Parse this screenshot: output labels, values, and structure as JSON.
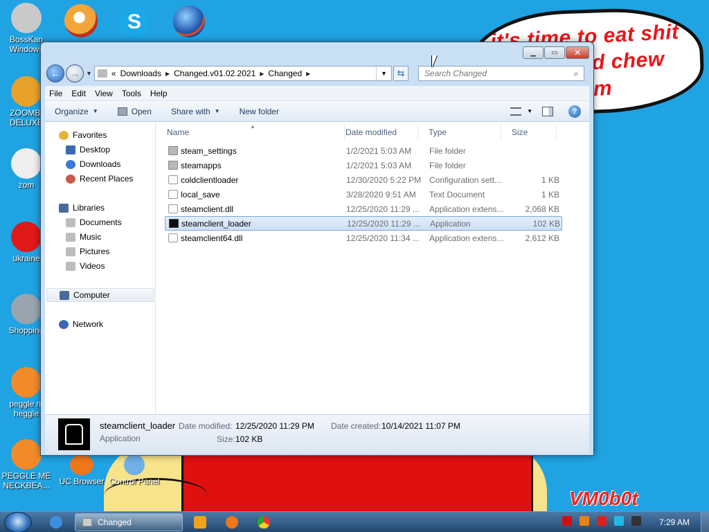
{
  "desktop": {
    "bubble_lines": [
      "it's time to eat shit",
      "d chew",
      "m"
    ],
    "watermark": "VM0b0t",
    "left_icons": [
      {
        "label": "BossKan\nWindows",
        "color": "#c9c9c9"
      },
      {
        "label": "ZOOMBI\nDELUXE",
        "color": "#e8a12a"
      },
      {
        "label": "zom",
        "color": "#eeeeee"
      },
      {
        "label": "ukraine",
        "color": "#e01818"
      },
      {
        "label": "Shopping",
        "color": "#9aa4ae"
      },
      {
        "label": "peggle m\nheggle",
        "color": "#f08a2a"
      },
      {
        "label": "PEGGLE ME\nNECKBEA...",
        "color": "#f08a2a"
      }
    ],
    "bottom_icons": [
      {
        "label": "UC Browser",
        "color": "#f0761a"
      },
      {
        "label": "Control Panel",
        "color": "#6fb0e6"
      }
    ],
    "top_icons": [
      {
        "name": "peggle-icon",
        "color": "#f2a53a"
      },
      {
        "name": "skype-icon",
        "color": "#1aa8e8"
      },
      {
        "name": "browser-globe-icon",
        "color": "#e04a1a"
      }
    ]
  },
  "window": {
    "address": {
      "prefix": "«",
      "crumbs": [
        "Downloads",
        "Changed.v01.02.2021",
        "Changed"
      ]
    },
    "search_placeholder": "Search Changed",
    "menu": [
      "File",
      "Edit",
      "View",
      "Tools",
      "Help"
    ],
    "toolbar": {
      "organize": "Organize",
      "open": "Open",
      "share_with": "Share with",
      "new_folder": "New folder"
    },
    "nav": {
      "favorites": "Favorites",
      "desktop": "Desktop",
      "downloads": "Downloads",
      "recent_places": "Recent Places",
      "libraries": "Libraries",
      "documents": "Documents",
      "music": "Music",
      "pictures": "Pictures",
      "videos": "Videos",
      "computer": "Computer",
      "network": "Network"
    },
    "columns": {
      "name": "Name",
      "date_modified": "Date modified",
      "type": "Type",
      "size": "Size"
    },
    "files": [
      {
        "name": "steam_settings",
        "date": "1/2/2021 5:03 AM",
        "type": "File folder",
        "size": "",
        "kind": "folder",
        "selected": false
      },
      {
        "name": "steamapps",
        "date": "1/2/2021 5:03 AM",
        "type": "File folder",
        "size": "",
        "kind": "folder",
        "selected": false
      },
      {
        "name": "coldclientloader",
        "date": "12/30/2020 5:22 PM",
        "type": "Configuration sett...",
        "size": "1 KB",
        "kind": "file",
        "selected": false
      },
      {
        "name": "local_save",
        "date": "3/28/2020 9:51 AM",
        "type": "Text Document",
        "size": "1 KB",
        "kind": "file",
        "selected": false
      },
      {
        "name": "steamclient.dll",
        "date": "12/25/2020 11:29 ...",
        "type": "Application extens...",
        "size": "2,068 KB",
        "kind": "file",
        "selected": false
      },
      {
        "name": "steamclient_loader",
        "date": "12/25/2020 11:29 ...",
        "type": "Application",
        "size": "102 KB",
        "kind": "app",
        "selected": true
      },
      {
        "name": "steamclient64.dll",
        "date": "12/25/2020 11:34 ...",
        "type": "Application extens...",
        "size": "2,612 KB",
        "kind": "file",
        "selected": false
      }
    ],
    "details": {
      "name": "steamclient_loader",
      "type": "Application",
      "date_modified_label": "Date modified:",
      "date_modified": "12/25/2020 11:29 PM",
      "date_created_label": "Date created:",
      "date_created": "10/14/2021 11:07 PM",
      "size_label": "Size:",
      "size": "102 KB"
    }
  },
  "taskbar": {
    "active_task": "Changed",
    "clock": "7:29 AM",
    "tray_icons": [
      {
        "name": "v-tray-icon",
        "color": "#d01010"
      },
      {
        "name": "search-tray-icon",
        "color": "#e8801a"
      },
      {
        "name": "flag-tray-icon",
        "color": "#e02020"
      },
      {
        "name": "monitor-tray-icon",
        "color": "#22b8e8"
      },
      {
        "name": "volume-tray-icon",
        "color": "#333333"
      }
    ]
  }
}
